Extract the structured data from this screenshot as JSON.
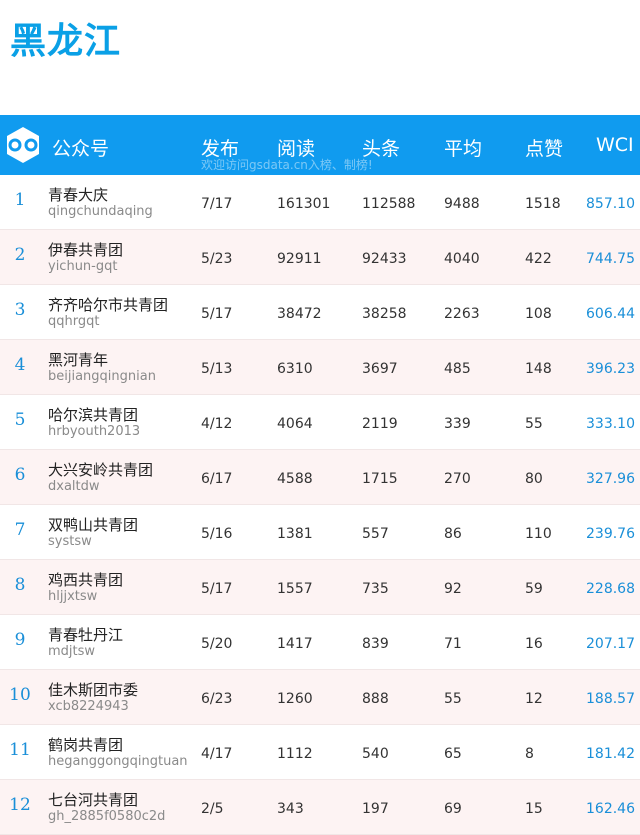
{
  "page": {
    "title": "黑龙江",
    "accent_color": "#109bef"
  },
  "header": {
    "logo_icon": "infinity-link-icon",
    "columns": {
      "account": "公众号",
      "publish": "发布",
      "reads": "阅读",
      "headline": "头条",
      "average": "平均",
      "likes": "点赞",
      "wci": "WCI"
    },
    "watermark": "欢迎访问gsdata.cn入榜、制榜!"
  },
  "rows": [
    {
      "rank": "1",
      "name": "青春大庆",
      "account": "qingchundaqing",
      "publish": "7/17",
      "reads": "161301",
      "headline": "112588",
      "average": "9488",
      "likes": "1518",
      "wci": "857.10"
    },
    {
      "rank": "2",
      "name": "伊春共青团",
      "account": "yichun-gqt",
      "publish": "5/23",
      "reads": "92911",
      "headline": "92433",
      "average": "4040",
      "likes": "422",
      "wci": "744.75"
    },
    {
      "rank": "3",
      "name": "齐齐哈尔市共青团",
      "account": "qqhrgqt",
      "publish": "5/17",
      "reads": "38472",
      "headline": "38258",
      "average": "2263",
      "likes": "108",
      "wci": "606.44"
    },
    {
      "rank": "4",
      "name": "黑河青年",
      "account": "beijiangqingnian",
      "publish": "5/13",
      "reads": "6310",
      "headline": "3697",
      "average": "485",
      "likes": "148",
      "wci": "396.23"
    },
    {
      "rank": "5",
      "name": "哈尔滨共青团",
      "account": "hrbyouth2013",
      "publish": "4/12",
      "reads": "4064",
      "headline": "2119",
      "average": "339",
      "likes": "55",
      "wci": "333.10"
    },
    {
      "rank": "6",
      "name": "大兴安岭共青团",
      "account": "dxaltdw",
      "publish": "6/17",
      "reads": "4588",
      "headline": "1715",
      "average": "270",
      "likes": "80",
      "wci": "327.96"
    },
    {
      "rank": "7",
      "name": "双鸭山共青团",
      "account": "systsw",
      "publish": "5/16",
      "reads": "1381",
      "headline": "557",
      "average": "86",
      "likes": "110",
      "wci": "239.76"
    },
    {
      "rank": "8",
      "name": "鸡西共青团",
      "account": "hljjxtsw",
      "publish": "5/17",
      "reads": "1557",
      "headline": "735",
      "average": "92",
      "likes": "59",
      "wci": "228.68"
    },
    {
      "rank": "9",
      "name": "青春牡丹江",
      "account": "mdjtsw",
      "publish": "5/20",
      "reads": "1417",
      "headline": "839",
      "average": "71",
      "likes": "16",
      "wci": "207.17"
    },
    {
      "rank": "10",
      "name": "佳木斯团市委",
      "account": "xcb8224943",
      "publish": "6/23",
      "reads": "1260",
      "headline": "888",
      "average": "55",
      "likes": "12",
      "wci": "188.57"
    },
    {
      "rank": "11",
      "name": "鹤岗共青团",
      "account": "heganggongqingtuan",
      "publish": "4/17",
      "reads": "1112",
      "headline": "540",
      "average": "65",
      "likes": "8",
      "wci": "181.42"
    },
    {
      "rank": "12",
      "name": "七台河共青团",
      "account": "gh_2885f0580c2d",
      "publish": "2/5",
      "reads": "343",
      "headline": "197",
      "average": "69",
      "likes": "15",
      "wci": "162.46"
    }
  ]
}
